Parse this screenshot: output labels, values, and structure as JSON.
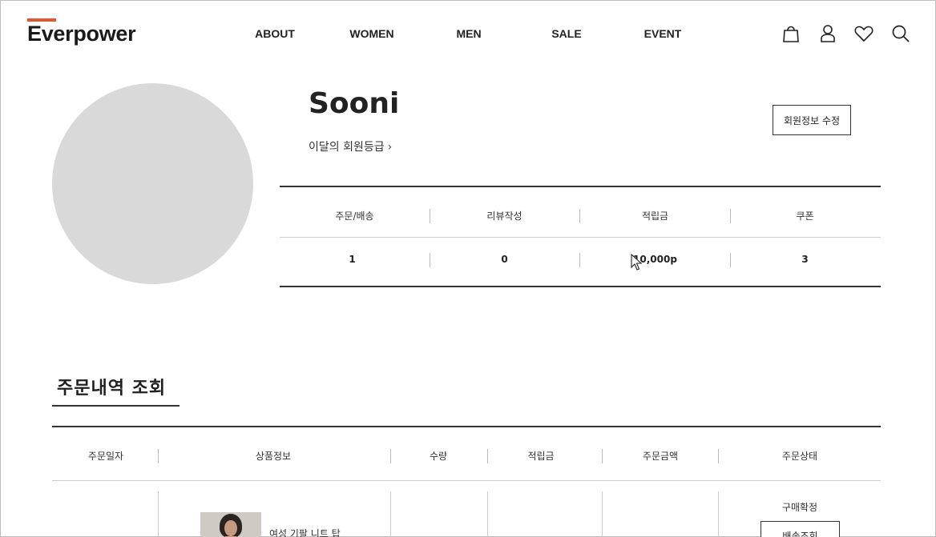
{
  "brand": {
    "logo_text": "Everpower",
    "accent_color": "#e4572e"
  },
  "nav": {
    "items": [
      "ABOUT",
      "WOMEN",
      "MEN",
      "SALE",
      "EVENT"
    ]
  },
  "header_icons": [
    "shopping-bag-icon",
    "user-icon",
    "heart-icon",
    "search-icon"
  ],
  "profile": {
    "username": "Sooni",
    "grade_link": "이달의 회원등급",
    "edit_button": "회원정보 수정"
  },
  "summary": {
    "headers": [
      "주문/배송",
      "리뷰작성",
      "적립금",
      "쿠폰"
    ],
    "values": [
      "1",
      "0",
      "10,000p",
      "3"
    ]
  },
  "orders": {
    "title": "주문내역 조회",
    "headers": [
      "주문일자",
      "상품정보",
      "수량",
      "적립금",
      "주문금액",
      "주문상태"
    ],
    "row": {
      "product_name": "여성 기팔 니트 탑",
      "status": "구매확정",
      "action_button": "배송조회"
    }
  }
}
